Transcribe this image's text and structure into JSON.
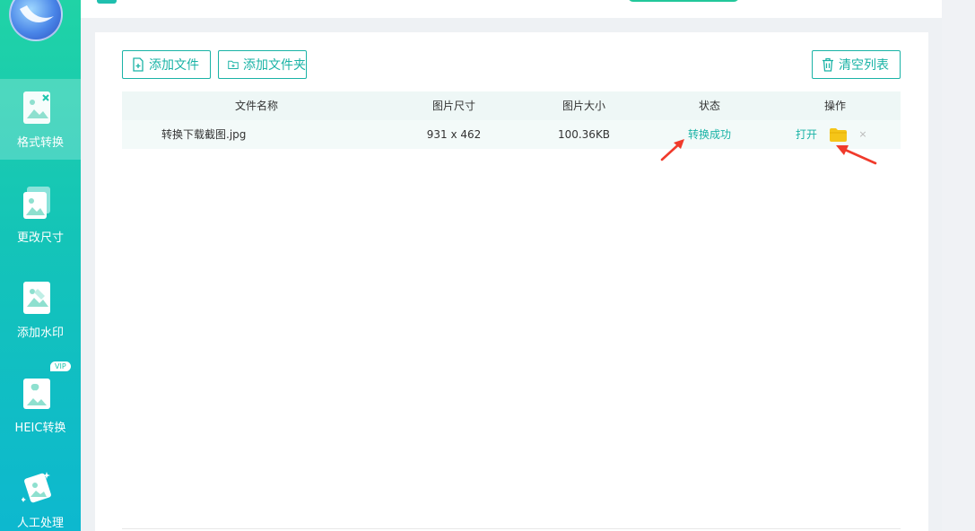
{
  "sidebar": {
    "items": [
      {
        "label": "格式转换",
        "icon": "image-convert-icon"
      },
      {
        "label": "更改尺寸",
        "icon": "image-resize-icon"
      },
      {
        "label": "添加水印",
        "icon": "image-watermark-icon"
      },
      {
        "label": "HEIC转换",
        "icon": "heic-apple-icon",
        "badge": "VIP"
      },
      {
        "label": "人工处理",
        "icon": "manual-process-icon"
      }
    ]
  },
  "toolbar": {
    "add_file": "添加文件",
    "add_folder": "添加文件夹",
    "clear_list": "清空列表"
  },
  "table": {
    "headers": [
      "文件名称",
      "图片尺寸",
      "图片大小",
      "状态",
      "操作"
    ],
    "rows": [
      {
        "name": "转换下载截图.jpg",
        "dimensions": "931 x 462",
        "size": "100.36KB",
        "status": "转换成功",
        "open": "打开",
        "remove": "×"
      }
    ]
  },
  "colors": {
    "accent": "#1ab3a6",
    "sidebar_top": "#20d3a6",
    "sidebar_bottom": "#0db8cf",
    "folder": "#f5c518",
    "annotation_arrow": "#f03a2b"
  }
}
